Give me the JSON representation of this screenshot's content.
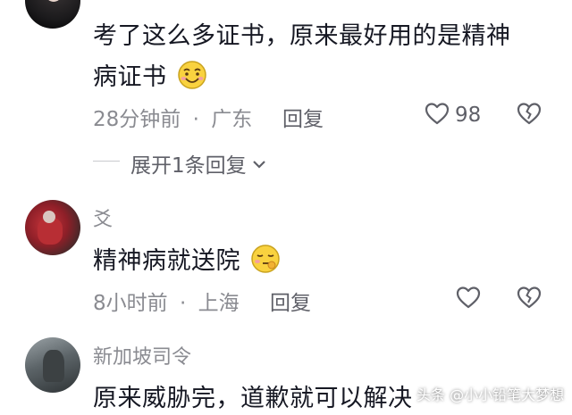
{
  "comments": [
    {
      "username": "",
      "text_line1": "考了这么多证书，原来最好用的是精神",
      "text_line2": "病证书",
      "time": "28分钟前",
      "location": "广东",
      "reply_label": "回复",
      "likes": "98",
      "emoji": "smiling-face-icon"
    },
    {
      "username": "爻",
      "text": "精神病就送院",
      "time": "8小时前",
      "location": "上海",
      "reply_label": "回复",
      "likes": "",
      "emoji": "zipper-mouth-face-icon"
    },
    {
      "username": "新加坡司令",
      "text": "原来威胁完，道歉就可以解决",
      "time": "",
      "location": "",
      "reply_label": "",
      "likes": ""
    }
  ],
  "expand_replies": "展开1条回复",
  "separator": "·",
  "watermark": "头条 @小小铅笔大梦想",
  "colors": {
    "text_primary": "#161823",
    "text_secondary": "#8a8b91",
    "divider": "#c9cace"
  }
}
